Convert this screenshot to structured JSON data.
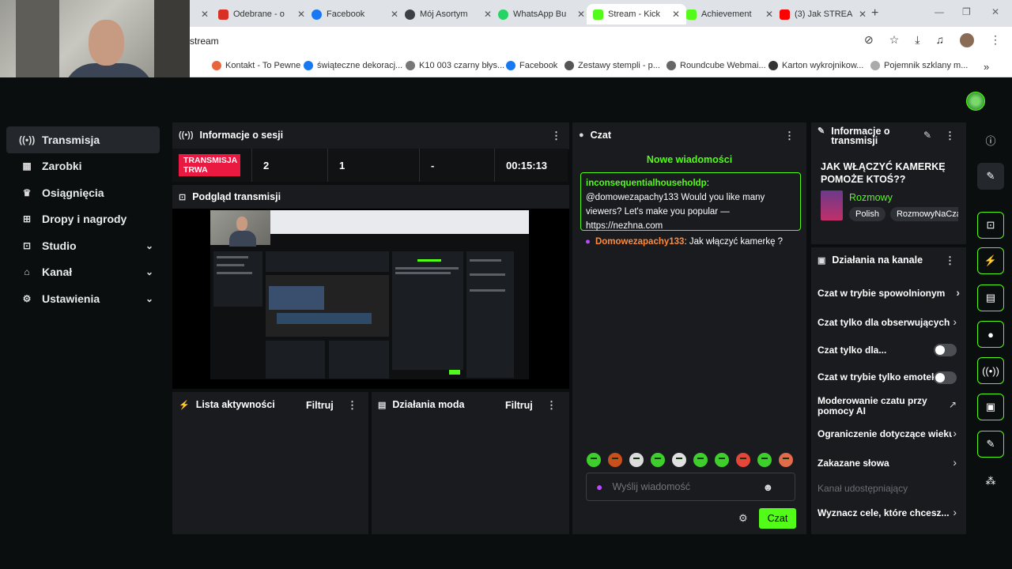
{
  "browser": {
    "tabs": [
      {
        "label": "Odebrane - o",
        "color": "#d93025"
      },
      {
        "label": "Facebook",
        "color": "#1877f2"
      },
      {
        "label": "Mój Asortym",
        "color": "#3c4043"
      },
      {
        "label": "WhatsApp Bu",
        "color": "#25d366"
      },
      {
        "label": "Stream - Kick",
        "color": "#53fc18"
      },
      {
        "label": "Achievement",
        "color": "#53fc18"
      },
      {
        "label": "(3) Jak STREA",
        "color": "#ff0000"
      }
    ],
    "url": "stream",
    "bookmarks": [
      "Kontakt - To Pewne",
      "świąteczne dekoracj...",
      "K10 003 czarny błys...",
      "Facebook",
      "Zestawy stempli - p...",
      "Roundcube Webmai...",
      "Karton wykrojnikow...",
      "Pojemnik szklany m..."
    ]
  },
  "sidebar": {
    "items": [
      {
        "label": "Transmisja",
        "icon": "broadcast-icon",
        "glyph": "((•))"
      },
      {
        "label": "Zarobki",
        "icon": "chart-icon",
        "glyph": "▦"
      },
      {
        "label": "Osiągnięcia",
        "icon": "trophy-icon",
        "glyph": "♛"
      },
      {
        "label": "Dropy i nagrody",
        "icon": "drops-icon",
        "glyph": "⊞"
      },
      {
        "label": "Studio",
        "icon": "studio-icon",
        "glyph": "⊡"
      },
      {
        "label": "Kanał",
        "icon": "home-icon",
        "glyph": "⌂"
      },
      {
        "label": "Ustawienia",
        "icon": "gear-icon",
        "glyph": "⚙"
      }
    ]
  },
  "session": {
    "title": "Informacje o sesji",
    "live_badge": "TRANSMISJA TRWA",
    "stat1": "2",
    "stat2": "1",
    "stat3": "-",
    "duration": "00:15:13"
  },
  "preview": {
    "title": "Podgląd transmisji"
  },
  "activity": {
    "title": "Lista aktywności",
    "filter": "Filtruj"
  },
  "mod": {
    "title": "Działania moda",
    "filter": "Filtruj"
  },
  "chat": {
    "title": "Czat",
    "new_messages": "Nowe wiadomości",
    "highlight_user": "inconsequentialhouseholdp",
    "highlight_text": "@domowezapachy133 Would you like many viewers? Let's make you popular — https://nezhna.com",
    "message_user": "Domowezapachy133",
    "message_text": "Jak włączyć kamerkę ?",
    "input_placeholder": "Wyślij wiadomość",
    "send_label": "Czat"
  },
  "stream_info": {
    "title": "Informacje o transmisji",
    "stream_title": "JAK WŁĄCZYĆ KAMERKĘ POMOŻE KTOŚ??",
    "category": "Rozmowy",
    "tags": [
      "Polish",
      "RozmowyNaCzacie"
    ]
  },
  "channel_actions": {
    "title": "Działania na kanale",
    "items": [
      "Czat w trybie spowolnionym",
      "Czat tylko dla obserwujących",
      "Czat tylko dla...",
      "Czat w trybie tylko emotek",
      "Moderowanie czatu przy pomocy AI",
      "Ograniczenie dotyczące wieku",
      "Zakazane słowa",
      "Kanał udostępniający",
      "Wyznacz cele, które chcesz..."
    ]
  },
  "colors": {
    "accent": "#53fc18",
    "live": "#e91942",
    "panel": "#191b1f"
  }
}
